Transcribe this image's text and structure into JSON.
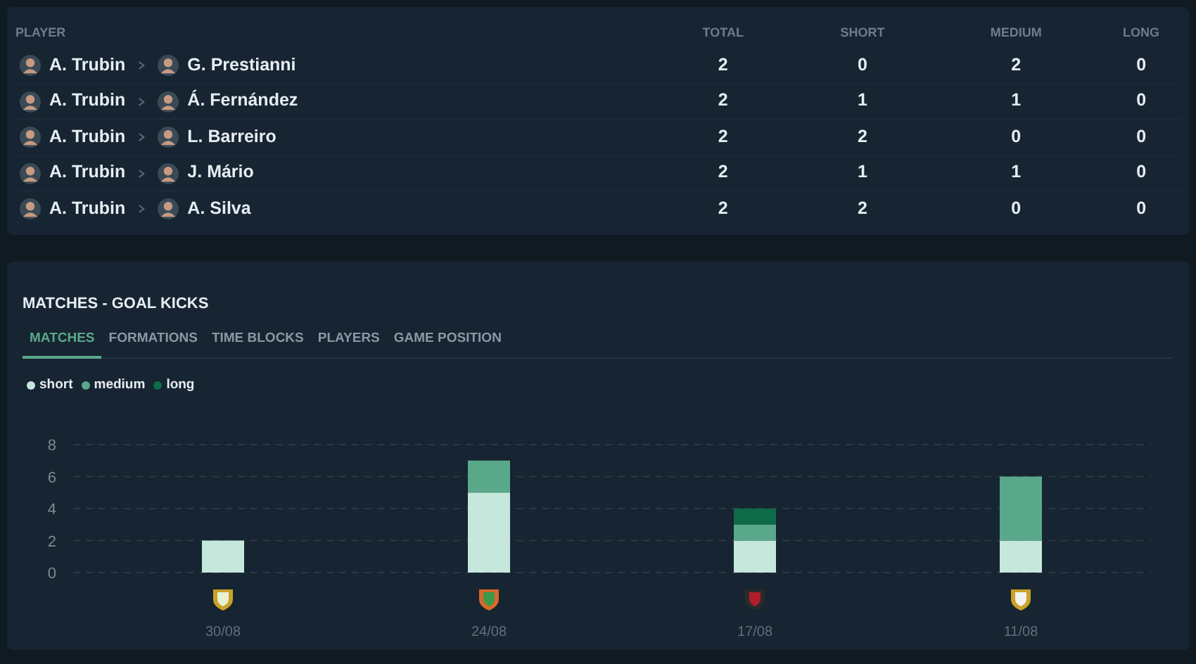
{
  "pairs_table": {
    "columns": [
      "PLAYER",
      "TOTAL",
      "SHORT",
      "MEDIUM",
      "LONG"
    ],
    "rows": [
      {
        "from": "A. Trubin",
        "to": "G. Prestianni",
        "total": "2",
        "short": "0",
        "medium": "2",
        "long": "0"
      },
      {
        "from": "A. Trubin",
        "to": "Á. Fernández",
        "total": "2",
        "short": "1",
        "medium": "1",
        "long": "0"
      },
      {
        "from": "A. Trubin",
        "to": "L. Barreiro",
        "total": "2",
        "short": "2",
        "medium": "0",
        "long": "0"
      },
      {
        "from": "A. Trubin",
        "to": "J. Mário",
        "total": "2",
        "short": "1",
        "medium": "1",
        "long": "0"
      },
      {
        "from": "A. Trubin",
        "to": "A. Silva",
        "total": "2",
        "short": "2",
        "medium": "0",
        "long": "0"
      }
    ]
  },
  "matches_panel": {
    "title": "MATCHES - GOAL KICKS",
    "tabs": [
      {
        "label": "MATCHES",
        "selected": true
      },
      {
        "label": "FORMATIONS",
        "selected": false
      },
      {
        "label": "TIME BLOCKS",
        "selected": false
      },
      {
        "label": "PLAYERS",
        "selected": false
      },
      {
        "label": "GAME POSITION",
        "selected": false
      }
    ],
    "chart_data": {
      "type": "bar",
      "stacked": true,
      "grid": true,
      "categories": [
        "30/08",
        "24/08",
        "17/08",
        "11/08"
      ],
      "ylim": [
        0,
        8
      ],
      "yticks": [
        0,
        2,
        4,
        6,
        8
      ],
      "series": [
        {
          "name": "short",
          "color": "#c6e8dc",
          "values": [
            2,
            5,
            2,
            2
          ]
        },
        {
          "name": "medium",
          "color": "#5aa88a",
          "values": [
            0,
            2,
            1,
            4
          ]
        },
        {
          "name": "long",
          "color": "#0d6b48",
          "values": [
            0,
            0,
            1,
            0
          ]
        }
      ]
    }
  }
}
